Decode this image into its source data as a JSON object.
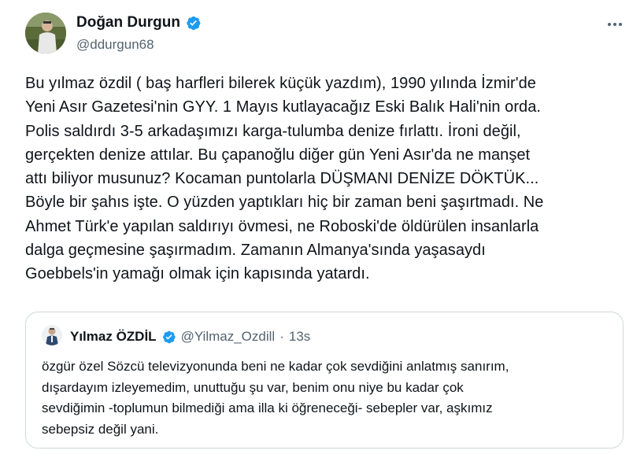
{
  "author": {
    "name": "Doğan Durgun",
    "handle": "@ddurgun68",
    "verified_color": "#1d9bf0"
  },
  "more_icon": "more-horizontal-icon",
  "tweet": {
    "lines": [
      "Bu yılmaz özdil ( baş harfleri bilerek küçük yazdım), 1990 yılında İzmir'de",
      "Yeni Asır Gazetesi'nin GYY. 1 Mayıs kutlayacağız Eski Balık Hali'nin orda.",
      "Polis saldırdı 3-5 arkadaşımızı karga-tulumba denize fırlattı. İroni değil,",
      "gerçekten denize attılar. Bu çapanoğlu diğer gün Yeni Asır'da ne manşet",
      "attı biliyor musunuz? Kocaman puntolarla DÜŞMANI DENİZE DÖKTÜK...",
      "Böyle bir şahıs işte. O yüzden yaptıkları hiç bir zaman beni şaşırtmadı. Ne",
      "Ahmet Türk'e yapılan saldırıyı övmesi, ne Roboski'de öldürülen insanlarla",
      "dalga geçmesine şaşırmadım. Zamanın Almanya'sında yaşasaydı",
      "Goebbels'in yamağı olmak için kapısında yatardı."
    ]
  },
  "quote": {
    "name": "Yılmaz ÖZDİL",
    "handle": "@Yilmaz_Ozdill",
    "separator": "·",
    "time": "13s",
    "lines": [
      "özgür özel Sözcü televizyonunda beni ne kadar çok sevdiğini anlatmış sanırım,",
      "dışardayım izleyemedim, unuttuğu şu var, benim onu niye bu kadar çok",
      "sevdiğimin -toplumun bilmediği ama illa ki öğreneceği- sebepler var, aşkımız",
      "sebepsiz değil yani."
    ]
  }
}
